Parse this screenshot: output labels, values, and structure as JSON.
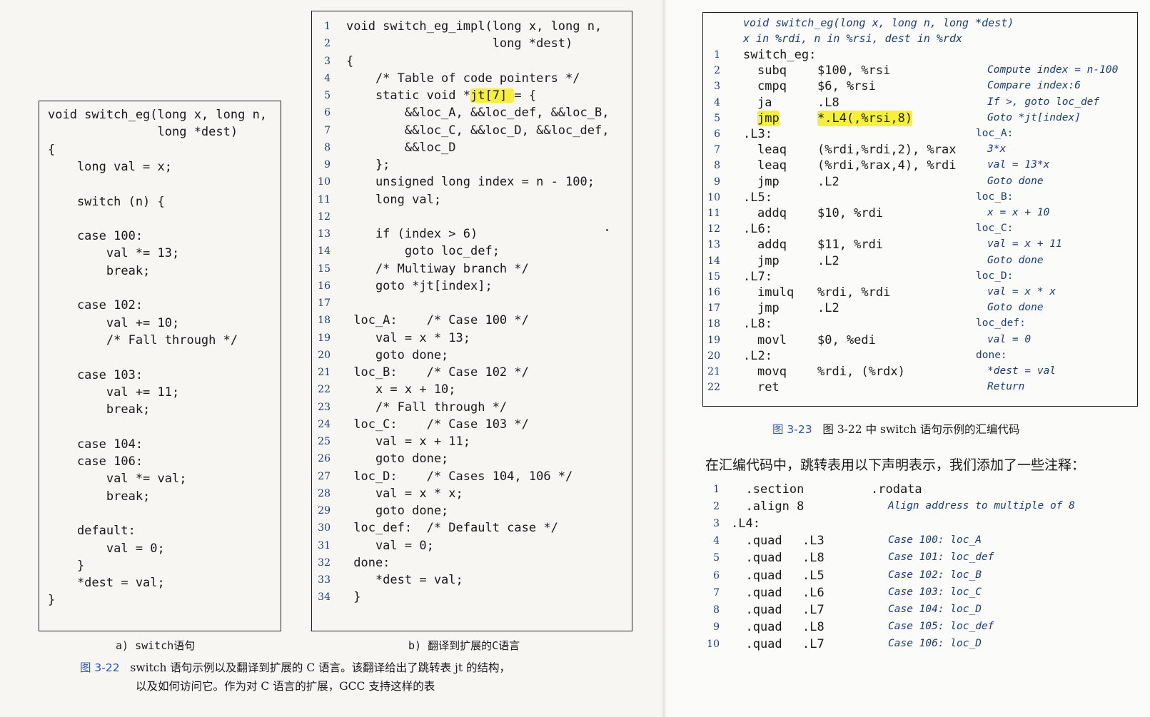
{
  "panel_a": {
    "lines": [
      "void switch_eg(long x, long n,",
      "               long *dest)",
      "{",
      "    long val = x;",
      "",
      "    switch (n) {",
      "",
      "    case 100:",
      "        val *= 13;",
      "        break;",
      "",
      "    case 102:",
      "        val += 10;",
      "        /* Fall through */",
      "",
      "    case 103:",
      "        val += 11;",
      "        break;",
      "",
      "    case 104:",
      "    case 106:",
      "        val *= val;",
      "        break;",
      "",
      "    default:",
      "        val = 0;",
      "    }",
      "    *dest = val;",
      "}"
    ],
    "label": "a) switch语句"
  },
  "panel_b": {
    "lines": [
      {
        "n": "1",
        "text": "void switch_eg_impl(long x, long n,"
      },
      {
        "n": "2",
        "text": "                    long *dest)"
      },
      {
        "n": "3",
        "text": "{"
      },
      {
        "n": "4",
        "text": "    /* Table of code pointers */"
      },
      {
        "n": "5",
        "text": "    static void *jt[7] = {",
        "hl_pre": "    static void *",
        "hl": "jt[7] ",
        "hl_post": "= {"
      },
      {
        "n": "6",
        "text": "        &&loc_A, &&loc_def, &&loc_B,"
      },
      {
        "n": "7",
        "text": "        &&loc_C, &&loc_D, &&loc_def,"
      },
      {
        "n": "8",
        "text": "        &&loc_D"
      },
      {
        "n": "9",
        "text": "    };"
      },
      {
        "n": "10",
        "text": "    unsigned long index = n - 100;"
      },
      {
        "n": "11",
        "text": "    long val;"
      },
      {
        "n": "12",
        "text": ""
      },
      {
        "n": "13",
        "text": "    if (index > 6)"
      },
      {
        "n": "14",
        "text": "        goto loc_def;"
      },
      {
        "n": "15",
        "text": "    /* Multiway branch */"
      },
      {
        "n": "16",
        "text": "    goto *jt[index];"
      },
      {
        "n": "17",
        "text": ""
      },
      {
        "n": "18",
        "text": " loc_A:    /* Case 100 */"
      },
      {
        "n": "19",
        "text": "    val = x * 13;"
      },
      {
        "n": "20",
        "text": "    goto done;"
      },
      {
        "n": "21",
        "text": " loc_B:    /* Case 102 */"
      },
      {
        "n": "22",
        "text": "    x = x + 10;"
      },
      {
        "n": "23",
        "text": "    /* Fall through */"
      },
      {
        "n": "24",
        "text": " loc_C:    /* Case 103 */"
      },
      {
        "n": "25",
        "text": "    val = x + 11;"
      },
      {
        "n": "26",
        "text": "    goto done;"
      },
      {
        "n": "27",
        "text": " loc_D:    /* Cases 104, 106 */"
      },
      {
        "n": "28",
        "text": "    val = x * x;"
      },
      {
        "n": "29",
        "text": "    goto done;"
      },
      {
        "n": "30",
        "text": " loc_def:  /* Default case */"
      },
      {
        "n": "31",
        "text": "    val = 0;"
      },
      {
        "n": "32",
        "text": " done:"
      },
      {
        "n": "33",
        "text": "    *dest = val;"
      },
      {
        "n": "34",
        "text": " }"
      }
    ],
    "label": "b) 翻译到扩展的C语言"
  },
  "caption_322": {
    "num": "图 3-22",
    "line1": "switch 语句示例以及翻译到扩展的 C 语言。该翻译给出了跳转表 jt 的结构，",
    "line2": "以及如何访问它。作为对 C 语言的扩展，GCC 支持这样的表"
  },
  "panel_c": {
    "header1": "void switch_eg(long x, long n, long *dest)",
    "header2": "x in %rdi, n in %rsi, dest in %rdx",
    "rows": [
      {
        "n": "1",
        "label": "switch_eg:",
        "op": "",
        "args": "",
        "cm": ""
      },
      {
        "n": "2",
        "label": "",
        "op": "subq",
        "args": "$100, %rsi",
        "cm": "Compute index = n-100"
      },
      {
        "n": "3",
        "label": "",
        "op": "cmpq",
        "args": "$6, %rsi",
        "cm": "Compare index:6"
      },
      {
        "n": "4",
        "label": "",
        "op": "ja",
        "args": ".L8",
        "cm": "If >, goto loc_def"
      },
      {
        "n": "5",
        "label": "",
        "op": "jmp",
        "args": "*.L4(,%rsi,8)",
        "cm": "Goto *jt[index]",
        "hl": true
      },
      {
        "n": "6",
        "label": ".L3:",
        "op": "",
        "args": "",
        "cm": "loc_A:",
        "cm_label": true
      },
      {
        "n": "7",
        "label": "",
        "op": "leaq",
        "args": "(%rdi,%rdi,2), %rax",
        "cm": "3*x"
      },
      {
        "n": "8",
        "label": "",
        "op": "leaq",
        "args": "(%rdi,%rax,4), %rdi",
        "cm": "val = 13*x"
      },
      {
        "n": "9",
        "label": "",
        "op": "jmp",
        "args": ".L2",
        "cm": "Goto done"
      },
      {
        "n": "10",
        "label": ".L5:",
        "op": "",
        "args": "",
        "cm": "loc_B:",
        "cm_label": true
      },
      {
        "n": "11",
        "label": "",
        "op": "addq",
        "args": "$10, %rdi",
        "cm": "x = x + 10"
      },
      {
        "n": "12",
        "label": ".L6:",
        "op": "",
        "args": "",
        "cm": "loc_C:",
        "cm_label": true
      },
      {
        "n": "13",
        "label": "",
        "op": "addq",
        "args": "$11, %rdi",
        "cm": "val = x + 11"
      },
      {
        "n": "14",
        "label": "",
        "op": "jmp",
        "args": ".L2",
        "cm": "Goto done"
      },
      {
        "n": "15",
        "label": ".L7:",
        "op": "",
        "args": "",
        "cm": "loc_D:",
        "cm_label": true
      },
      {
        "n": "16",
        "label": "",
        "op": "imulq",
        "args": "%rdi, %rdi",
        "cm": "val = x * x"
      },
      {
        "n": "17",
        "label": "",
        "op": "jmp",
        "args": ".L2",
        "cm": "Goto done"
      },
      {
        "n": "18",
        "label": ".L8:",
        "op": "",
        "args": "",
        "cm": "loc_def:",
        "cm_label": true
      },
      {
        "n": "19",
        "label": "",
        "op": "movl",
        "args": "$0, %edi",
        "cm": "val = 0"
      },
      {
        "n": "20",
        "label": ".L2:",
        "op": "",
        "args": "",
        "cm": "done:",
        "cm_label": true
      },
      {
        "n": "21",
        "label": "",
        "op": "movq",
        "args": "%rdi, (%rdx)",
        "cm": "*dest = val"
      },
      {
        "n": "22",
        "label": "",
        "op": "ret",
        "args": "",
        "cm": "Return"
      }
    ]
  },
  "caption_323": {
    "num": "图 3-23",
    "text": "图 3-22 中 switch 语句示例的汇编代码"
  },
  "paragraph": "在汇编代码中，跳转表用以下声明表示，我们添加了一些注释：",
  "jump_table": [
    {
      "n": "1",
      "a": "  .section",
      "b": ".rodata",
      "cm": ""
    },
    {
      "n": "2",
      "a": "  .align 8",
      "b": "",
      "cm": "Align address to multiple of 8"
    },
    {
      "n": "3",
      "a": ".L4:",
      "b": "",
      "cm": ""
    },
    {
      "n": "4",
      "a": "  .quad",
      "b": ".L3",
      "cm": "Case 100: loc_A"
    },
    {
      "n": "5",
      "a": "  .quad",
      "b": ".L8",
      "cm": "Case 101: loc_def"
    },
    {
      "n": "6",
      "a": "  .quad",
      "b": ".L5",
      "cm": "Case 102: loc_B"
    },
    {
      "n": "7",
      "a": "  .quad",
      "b": ".L6",
      "cm": "Case 103: loc_C"
    },
    {
      "n": "8",
      "a": "  .quad",
      "b": ".L7",
      "cm": "Case 104: loc_D"
    },
    {
      "n": "9",
      "a": "  .quad",
      "b": ".L8",
      "cm": "Case 105: loc_def"
    },
    {
      "n": "10",
      "a": "  .quad",
      "b": ".L7",
      "cm": "Case 106: loc_D"
    }
  ],
  "colors": {
    "highlight": "#f7f03a",
    "comment": "#1a3d7a",
    "caption_number": "#2a5ca8"
  }
}
